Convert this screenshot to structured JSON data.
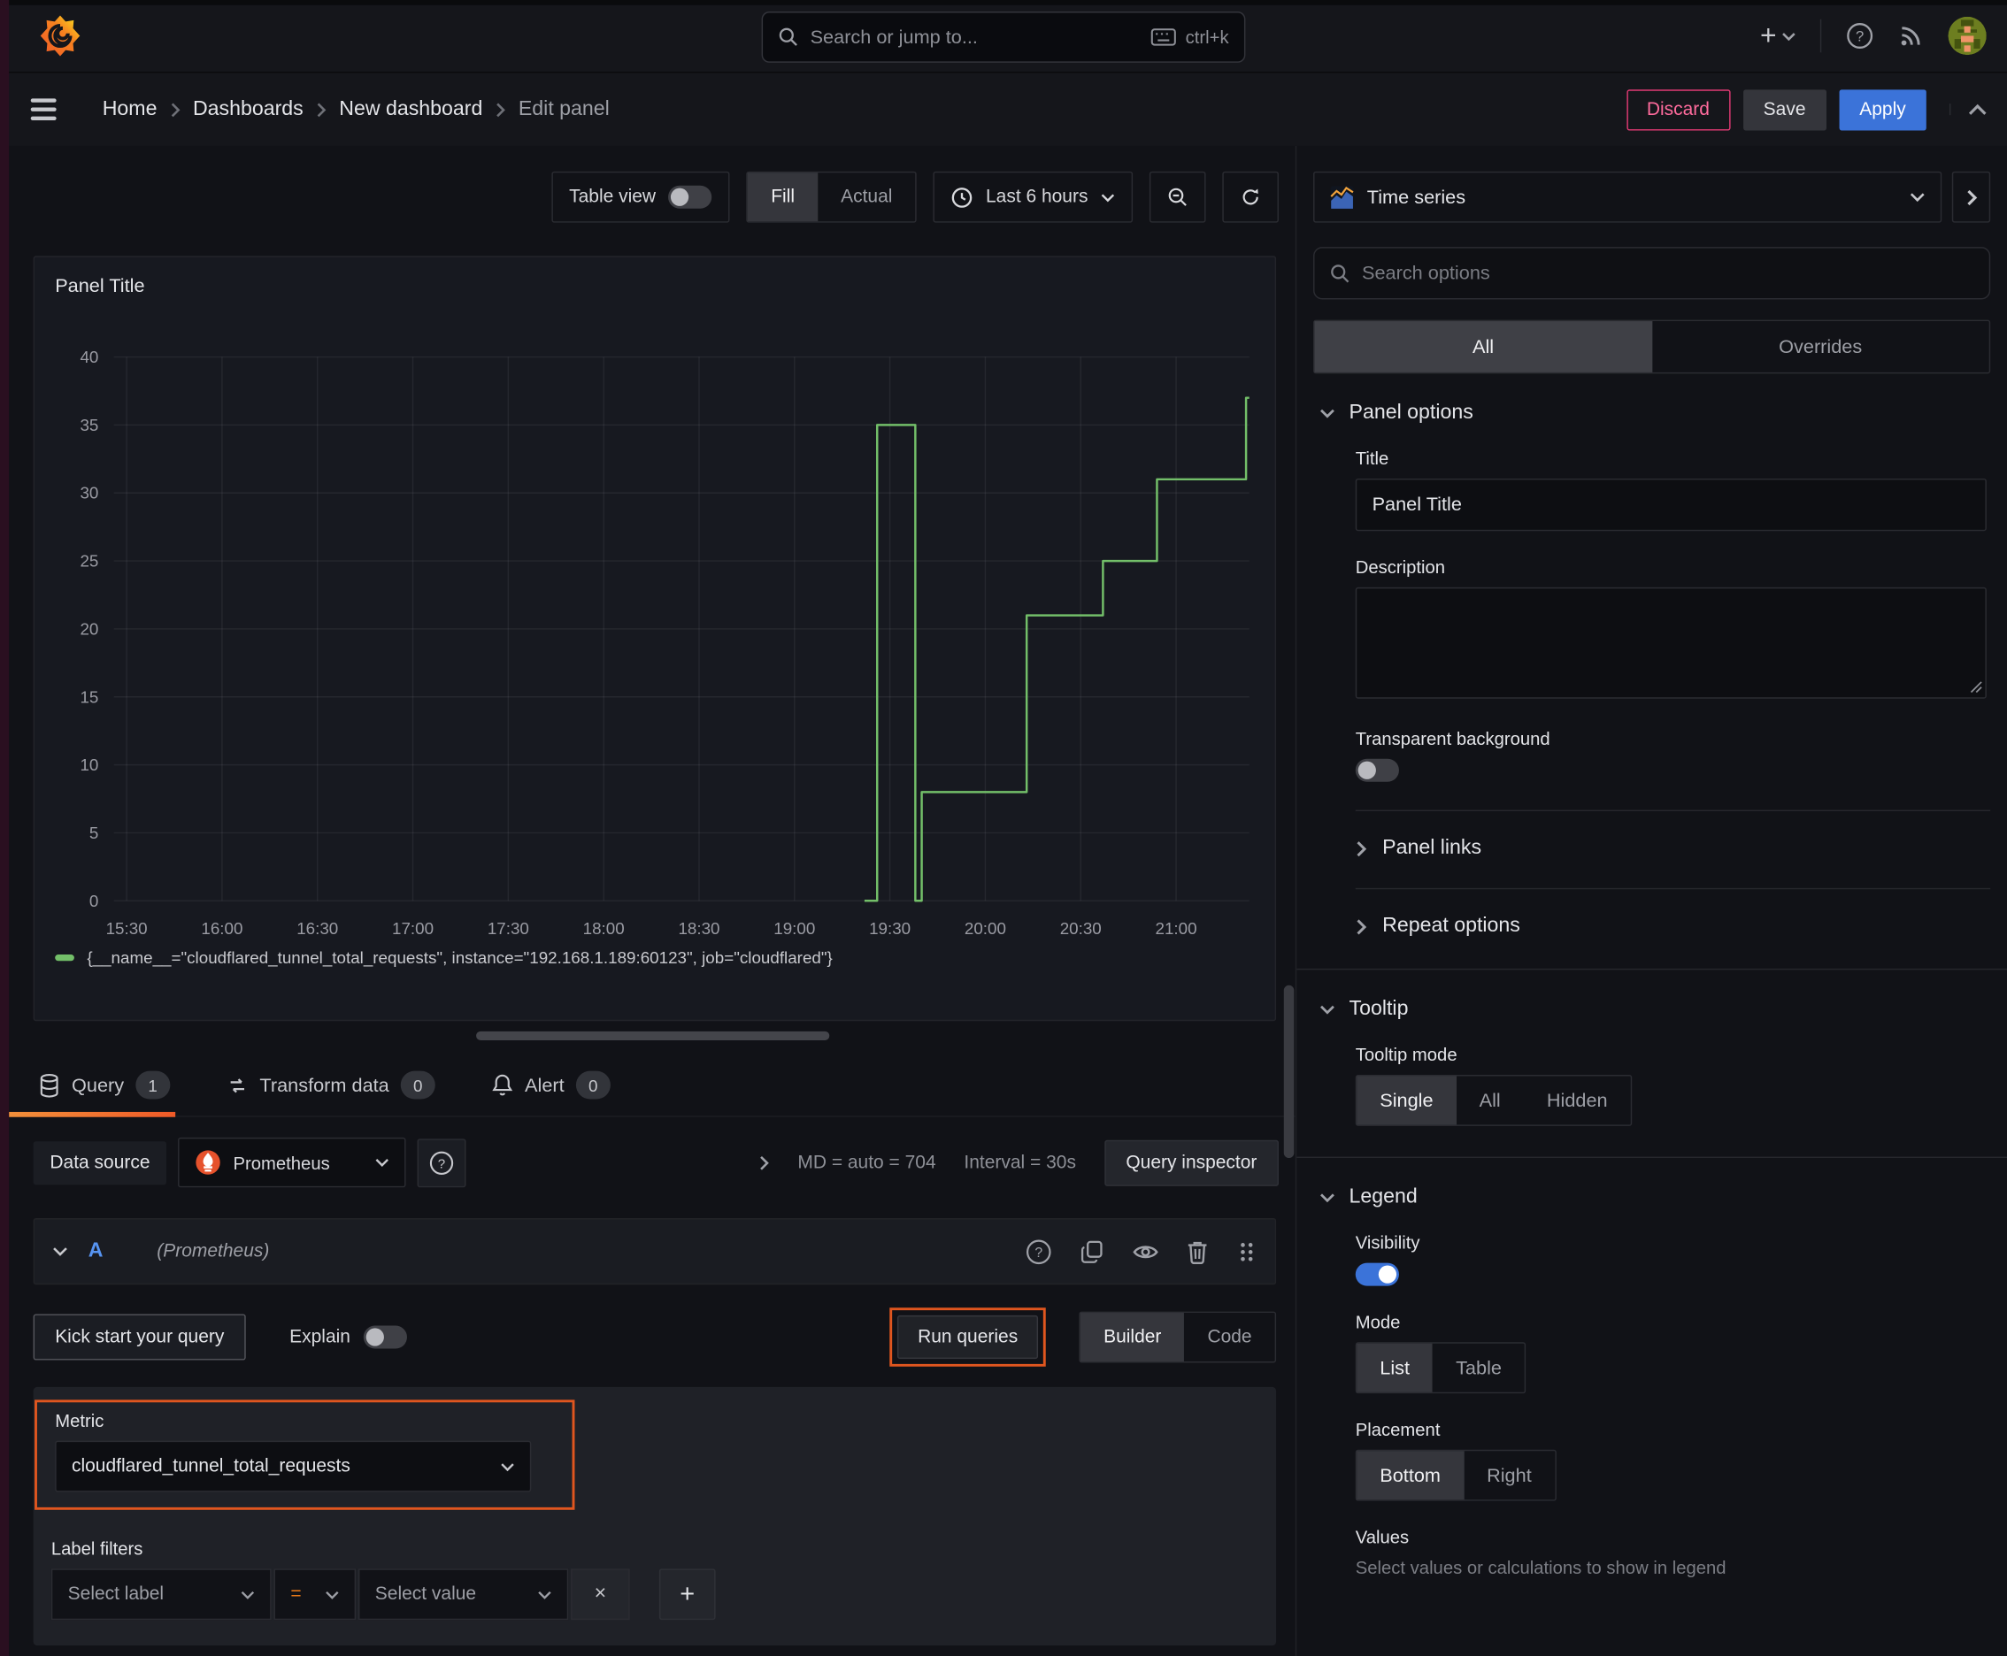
{
  "icons": {
    "plus": "+",
    "close": "×"
  },
  "chrome": {
    "search_placeholder": "Search or jump to...",
    "search_shortcut": "ctrl+k"
  },
  "breadcrumb": {
    "items": [
      "Home",
      "Dashboards",
      "New dashboard"
    ],
    "current": "Edit panel"
  },
  "header_actions": {
    "discard": "Discard",
    "save": "Save",
    "apply": "Apply"
  },
  "toolbar": {
    "table_view": "Table view",
    "fill": "Fill",
    "actual": "Actual",
    "time_range": "Last 6 hours"
  },
  "viz_picker": {
    "label": "Time series"
  },
  "options": {
    "search_placeholder": "Search options",
    "tab_all": "All",
    "tab_overrides": "Overrides",
    "panel_options": {
      "heading": "Panel options",
      "title_label": "Title",
      "title_value": "Panel Title",
      "description_label": "Description",
      "transparent_label": "Transparent background"
    },
    "links_heading": "Panel links",
    "repeat_heading": "Repeat options",
    "tooltip": {
      "heading": "Tooltip",
      "mode_label": "Tooltip mode",
      "modes": [
        "Single",
        "All",
        "Hidden"
      ],
      "selected": "Single"
    },
    "legend": {
      "heading": "Legend",
      "visibility_label": "Visibility",
      "mode_label": "Mode",
      "modes": [
        "List",
        "Table"
      ],
      "selected_mode": "List",
      "placement_label": "Placement",
      "placements": [
        "Bottom",
        "Right"
      ],
      "selected_placement": "Bottom",
      "values_label": "Values",
      "values_hint": "Select values or calculations to show in legend"
    }
  },
  "query_tabs": {
    "query": "Query",
    "query_count": "1",
    "transform": "Transform data",
    "transform_count": "0",
    "alert": "Alert",
    "alert_count": "0"
  },
  "datasource_row": {
    "label": "Data source",
    "value": "Prometheus",
    "md": "MD = auto = 704",
    "interval": "Interval = 30s",
    "inspector": "Query inspector"
  },
  "query_editor": {
    "ref": "A",
    "ds_hint": "(Prometheus)",
    "kick_start": "Kick start your query",
    "explain": "Explain",
    "run": "Run queries",
    "builder": "Builder",
    "code": "Code",
    "metric_label": "Metric",
    "metric_value": "cloudflared_tunnel_total_requests",
    "label_filters": "Label filters",
    "select_label": "Select label",
    "operator": "=",
    "select_value": "Select value"
  },
  "chart_data": {
    "type": "line",
    "step": true,
    "title": "Panel Title",
    "xlabel": "",
    "ylabel": "",
    "ylim": [
      0,
      40
    ],
    "ytick_step": 5,
    "grid": true,
    "legend_position": "bottom",
    "x_domain": [
      "15:26",
      "21:23"
    ],
    "xticks": [
      "15:30",
      "16:00",
      "16:30",
      "17:00",
      "17:30",
      "18:00",
      "18:30",
      "19:00",
      "19:30",
      "20:00",
      "20:30",
      "21:00"
    ],
    "series": [
      {
        "name": "{__name__=\"cloudflared_tunnel_total_requests\", instance=\"192.168.1.189:60123\", job=\"cloudflared\"}",
        "color": "#73bf69",
        "points": [
          [
            "19:22",
            0
          ],
          [
            "19:26",
            0
          ],
          [
            "19:26",
            35
          ],
          [
            "19:38",
            35
          ],
          [
            "19:38",
            0
          ],
          [
            "19:40",
            0
          ],
          [
            "19:40",
            8
          ],
          [
            "20:13",
            8
          ],
          [
            "20:13",
            21
          ],
          [
            "20:37",
            21
          ],
          [
            "20:37",
            25
          ],
          [
            "20:54",
            25
          ],
          [
            "20:54",
            31
          ],
          [
            "21:22",
            31
          ],
          [
            "21:22",
            37
          ],
          [
            "21:23",
            37
          ]
        ]
      }
    ]
  }
}
